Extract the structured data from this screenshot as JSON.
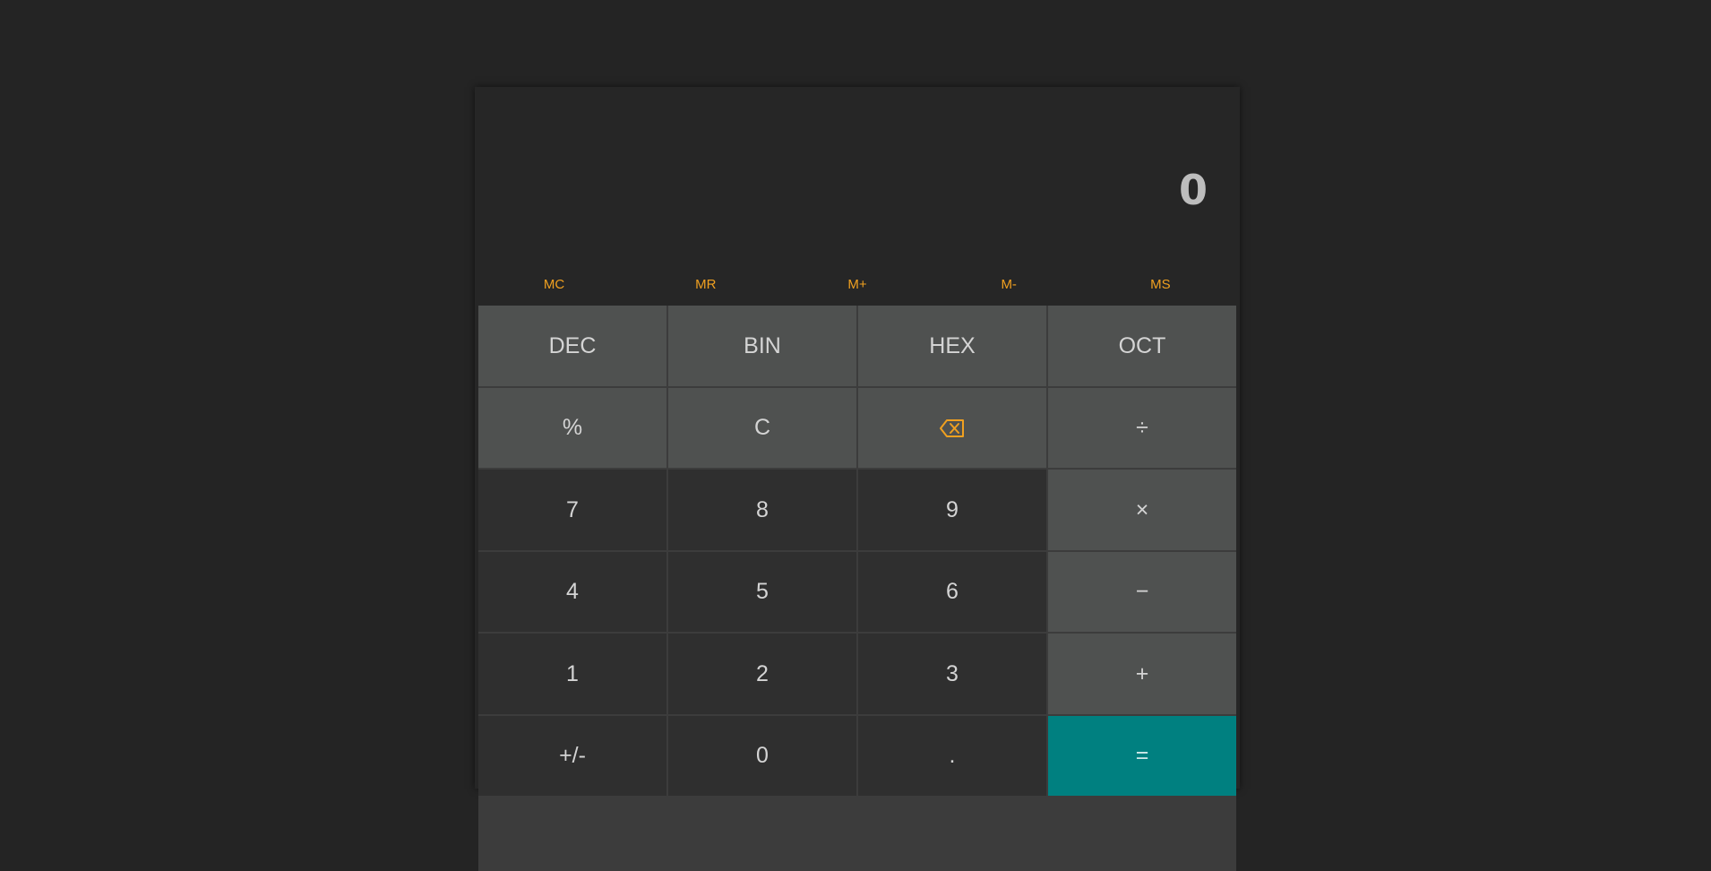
{
  "display": {
    "value": "0"
  },
  "memory": [
    "MC",
    "MR",
    "M+",
    "M-",
    "MS"
  ],
  "keys": {
    "dec": "DEC",
    "bin": "BIN",
    "hex": "HEX",
    "oct": "OCT",
    "percent": "%",
    "clear": "C",
    "divide": "÷",
    "seven": "7",
    "eight": "8",
    "nine": "9",
    "multiply": "×",
    "four": "4",
    "five": "5",
    "six": "6",
    "minus": "−",
    "one": "1",
    "two": "2",
    "three": "3",
    "plus": "+",
    "negate": "+/-",
    "zero": "0",
    "decimal": ".",
    "equals": "="
  },
  "colors": {
    "accent": "#f0a020",
    "equals": "#008080",
    "light_key": "#4f5150",
    "dark_key": "#2f2f2f",
    "background": "#242424"
  },
  "icons": {
    "backspace": "backspace-icon"
  }
}
